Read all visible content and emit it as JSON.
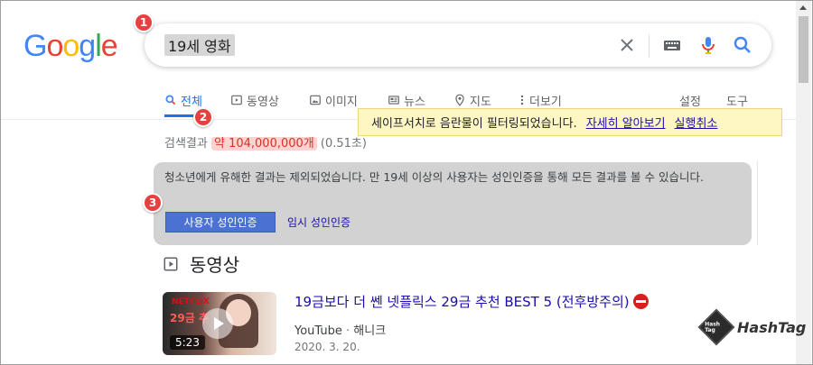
{
  "logo": {
    "letters": [
      "G",
      "o",
      "o",
      "g",
      "l",
      "e"
    ],
    "colors": [
      "#4285F4",
      "#EA4335",
      "#FBBC05",
      "#4285F4",
      "#34A853",
      "#EA4335"
    ]
  },
  "search": {
    "query": "19세 영화",
    "icons": [
      "close-icon",
      "keyboard-icon",
      "mic-icon",
      "search-icon"
    ]
  },
  "tabs": [
    {
      "label": "전체",
      "icon": "search-icon",
      "active": true
    },
    {
      "label": "동영상",
      "icon": "video-icon"
    },
    {
      "label": "이미지",
      "icon": "image-icon"
    },
    {
      "label": "뉴스",
      "icon": "news-icon"
    },
    {
      "label": "지도",
      "icon": "map-pin-icon"
    },
    {
      "label": "더보기",
      "icon": "more-vert-icon"
    },
    {
      "label": "설정"
    },
    {
      "label": "도구"
    }
  ],
  "safesearch": {
    "message": "세이프서치로 음란물이 필터링되었습니다.",
    "learn_more": "자세히 알아보기",
    "undo": "실행취소"
  },
  "stats": {
    "prefix": "검색결과",
    "count": "약 104,000,000개",
    "time": "(0.51초)"
  },
  "warning": {
    "text": "청소년에게 유해한 결과는 제외되었습니다. 만 19세 이상의 사용자는 성인인증을 통해 모든 결과를 볼 수 있습니다.",
    "verify_button": "사용자 성인인증",
    "temp_link": "임시 성인인증"
  },
  "videos": {
    "header": "동영상",
    "items": [
      {
        "title": "19금보다 더 쎈 넷플릭스 29금 추천 BEST 5 (전후방주의)",
        "source": "YouTube",
        "channel": "해니크",
        "date": "2020. 3. 20.",
        "duration": "5:23",
        "thumb_brand": "NETFLIX",
        "thumb_text": "29금 추"
      }
    ]
  },
  "markers": [
    "1",
    "2",
    "3"
  ],
  "watermark": {
    "text": "HashTag",
    "badge": "Hash Tag"
  }
}
